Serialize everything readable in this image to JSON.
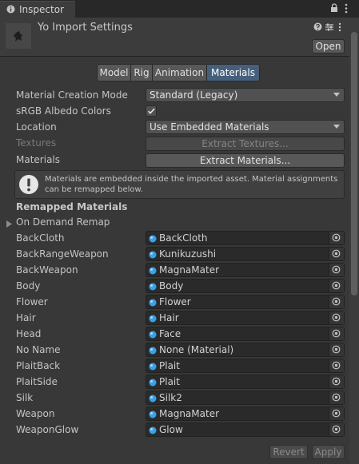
{
  "window": {
    "tab_title": "Inspector"
  },
  "header": {
    "title": "Yo Import Settings",
    "open_label": "Open"
  },
  "toolbar": {
    "tabs": [
      "Model",
      "Rig",
      "Animation",
      "Materials"
    ],
    "active": "Materials"
  },
  "settings": {
    "material_creation_mode": {
      "label": "Material Creation Mode",
      "value": "Standard (Legacy)"
    },
    "srgb_albedo": {
      "label": "sRGB Albedo Colors",
      "checked": true
    },
    "location": {
      "label": "Location",
      "value": "Use Embedded Materials"
    },
    "textures": {
      "label": "Textures",
      "button": "Extract Textures..."
    },
    "materials": {
      "label": "Materials",
      "button": "Extract Materials..."
    }
  },
  "help": {
    "text": "Materials are embedded inside the imported asset. Material assignments can be remapped below."
  },
  "remapped": {
    "title": "Remapped Materials",
    "foldout": "On Demand Remap",
    "rows": [
      {
        "name": "BackCloth",
        "value": "BackCloth"
      },
      {
        "name": "BackRangeWeapon",
        "value": "Kunikuzushi"
      },
      {
        "name": "BackWeapon",
        "value": "MagnaMater"
      },
      {
        "name": "Body",
        "value": "Body"
      },
      {
        "name": "Flower",
        "value": "Flower"
      },
      {
        "name": "Hair",
        "value": "Hair"
      },
      {
        "name": "Head",
        "value": "Face"
      },
      {
        "name": "No Name",
        "value": "None (Material)"
      },
      {
        "name": "PlaitBack",
        "value": "Plait"
      },
      {
        "name": "PlaitSide",
        "value": "Plait"
      },
      {
        "name": "Silk",
        "value": "Silk2"
      },
      {
        "name": "Weapon",
        "value": "MagnaMater"
      },
      {
        "name": "WeaponGlow",
        "value": "Glow"
      }
    ]
  },
  "footer": {
    "revert": "Revert",
    "apply": "Apply"
  },
  "colors": {
    "accent": "#46607c",
    "material_icon": "#3aa0e8",
    "background": "#383838"
  },
  "icons": [
    "info-icon",
    "lock-icon",
    "more-menu-icon",
    "help-icon",
    "presets-icon",
    "settings-icon",
    "warning-icon",
    "foldout-arrow-icon",
    "material-icon",
    "object-picker-icon",
    "checkmark-icon",
    "dropdown-arrow-icon"
  ]
}
